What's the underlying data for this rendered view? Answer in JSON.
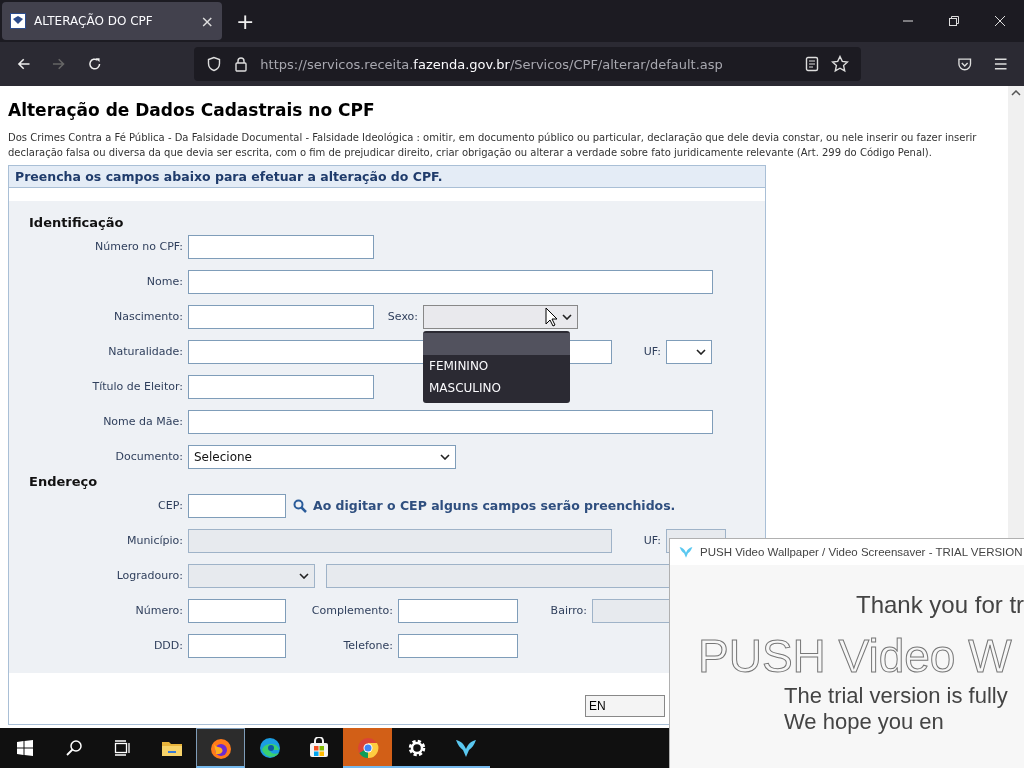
{
  "browser": {
    "tab": {
      "title": "ALTERAÇÃO DO CPF",
      "close": "×"
    },
    "new_tab": "+",
    "url": {
      "prefix": "https://servicos.receita.",
      "domain": "fazenda.gov.br",
      "path": "/Servicos/CPF/alterar/default.asp"
    }
  },
  "page": {
    "title": "Alteração de Dados Cadastrais no CPF",
    "notice": "Dos Crimes Contra a Fé Pública - Da Falsidade Documental - Falsidade Ideológica : omitir, em documento público ou particular, declaração que dele devia constar, ou nele inserir ou fazer inserir declaração falsa ou diversa da que devia ser escrita, com o fim de prejudicar direito, criar obrigação ou alterar a verdade sobre fato juridicamente relevante (Art. 299 do Código Penal).",
    "panel_header": "Preencha os campos abaixo para efetuar a alteração do CPF.",
    "sections": [
      {
        "title": "Identificação",
        "rows": [
          [
            {
              "label": "Número no CPF:",
              "kind": "text",
              "disabled": false
            }
          ],
          [
            {
              "label": "Nome:",
              "kind": "text",
              "disabled": false
            }
          ],
          [
            {
              "label": "Nascimento:",
              "kind": "text",
              "disabled": false
            },
            {
              "label": "Sexo:",
              "kind": "select",
              "disabled": false,
              "expanded": true,
              "options": [
                {
                  "selected": true
                },
                {
                  "text": "FEMININO",
                  "selected": false
                },
                {
                  "text": "MASCULINO",
                  "selected": false
                }
              ]
            }
          ],
          [
            {
              "label": "Naturalidade:",
              "kind": "text",
              "disabled": false
            },
            {
              "label": "UF:",
              "kind": "select",
              "disabled": false,
              "expanded": false
            }
          ],
          [
            {
              "label": "Título de Eleitor:",
              "kind": "text",
              "disabled": false
            }
          ],
          [
            {
              "label": "Nome da Mãe:",
              "kind": "text",
              "disabled": false
            }
          ],
          [
            {
              "label": "Documento:",
              "kind": "select",
              "disabled": false,
              "expanded": false,
              "value": "Selecione"
            }
          ]
        ]
      },
      {
        "title": "Endereço",
        "rows": [
          [
            {
              "label": "CEP:",
              "kind": "text",
              "disabled": false,
              "hint": "Ao digitar o CEP alguns campos serão preenchidos."
            }
          ],
          [
            {
              "label": "Município:",
              "kind": "text",
              "disabled": true
            },
            {
              "label": "UF:",
              "kind": "text",
              "disabled": true
            }
          ],
          [
            {
              "label": "Logradouro:",
              "kind": "select",
              "disabled": true,
              "expanded": false
            },
            {
              "kind": "text",
              "disabled": true
            }
          ],
          [
            {
              "label": "Número:",
              "kind": "text",
              "disabled": false
            },
            {
              "label": "Complemento:",
              "kind": "text",
              "disabled": false
            },
            {
              "label": "Bairro:",
              "kind": "text",
              "disabled": true
            }
          ],
          [
            {
              "label": "DDD:",
              "kind": "text",
              "disabled": false
            },
            {
              "label": "Telefone:",
              "kind": "text",
              "disabled": false
            }
          ]
        ]
      }
    ],
    "submit": "EN"
  },
  "popup": {
    "title": "PUSH Video Wallpaper / Video Screensaver - TRIAL VERSION",
    "thanks": "Thank you for tr",
    "logo": "PUSH Video W",
    "line1": "The trial version is fully",
    "line2": "We hope you en"
  },
  "taskbar": [
    {
      "kind": "start",
      "running": false,
      "selected": false,
      "attention": false
    },
    {
      "kind": "search",
      "running": false,
      "selected": false,
      "attention": false
    },
    {
      "kind": "taskview",
      "running": false,
      "selected": false,
      "attention": false
    },
    {
      "kind": "folder",
      "running": false,
      "selected": false,
      "attention": false
    },
    {
      "kind": "firefox",
      "running": true,
      "selected": true,
      "attention": false
    },
    {
      "kind": "edge",
      "running": false,
      "selected": false,
      "attention": false
    },
    {
      "kind": "store",
      "running": false,
      "selected": false,
      "attention": false
    },
    {
      "kind": "chrome",
      "running": true,
      "selected": false,
      "attention": true
    },
    {
      "kind": "gear",
      "running": true,
      "selected": false,
      "attention": false
    },
    {
      "kind": "bird",
      "running": true,
      "selected": false,
      "attention": false
    }
  ]
}
